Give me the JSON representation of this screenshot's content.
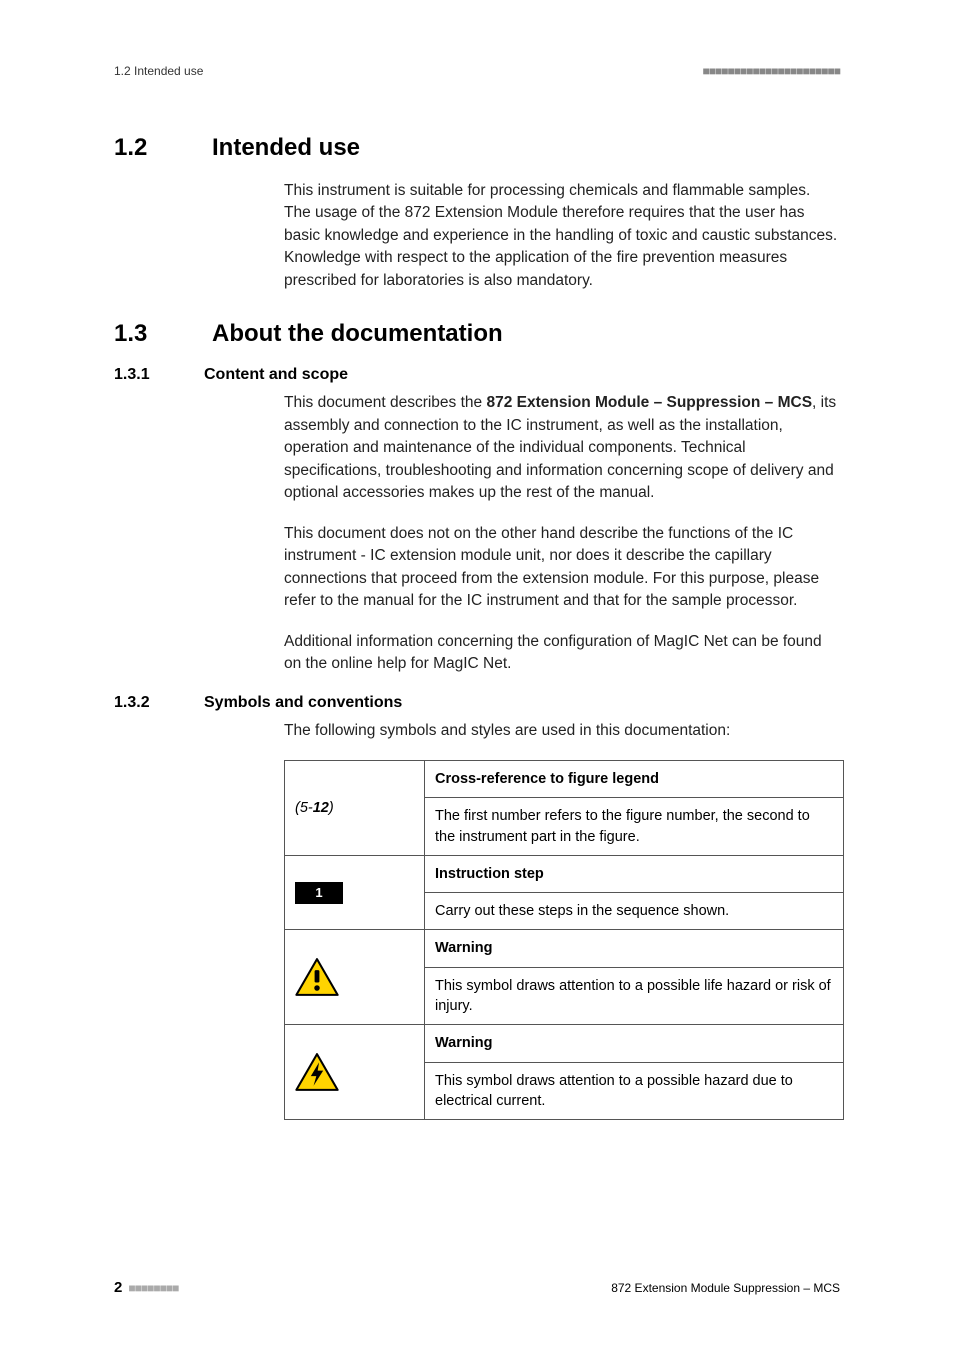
{
  "header": {
    "left": "1.2 Intended use",
    "right_dashes": "■■■■■■■■■■■■■■■■■■■■■■"
  },
  "sections": {
    "s12": {
      "num": "1.2",
      "title": "Intended use",
      "p1": "This instrument is suitable for processing chemicals and flammable samples. The usage of the 872 Extension Module therefore requires that the user has basic knowledge and experience in the handling of toxic and caustic substances. Knowledge with respect to the application of the fire prevention measures prescribed for laboratories is also mandatory."
    },
    "s13": {
      "num": "1.3",
      "title": "About the documentation",
      "s131": {
        "num": "1.3.1",
        "title": "Content and scope",
        "p1_prefix": "This document describes the ",
        "p1_bold": "872 Extension Module – Suppression – MCS",
        "p1_suffix": ", its assembly and connection to the IC instrument, as well as the installation, operation and maintenance of the individual components. Technical specifications, troubleshooting and information concerning scope of delivery and optional accessories makes up the rest of the manual.",
        "p2": "This document does not on the other hand describe the functions of the IC instrument - IC extension module unit, nor does it describe the capillary connections that proceed from the extension module. For this purpose, please refer to the manual for the IC instrument and that for the sample processor.",
        "p3": "Additional information concerning the configuration of MagIC Net can be found on the online help for MagIC Net."
      },
      "s132": {
        "num": "1.3.2",
        "title": "Symbols and conventions",
        "intro": "The following symbols and styles are used in this documentation:"
      }
    }
  },
  "table": {
    "row1": {
      "left_prefix": "(5-",
      "left_bold": "12",
      "left_suffix": ")",
      "heading": "Cross-reference to figure legend",
      "desc": "The first number refers to the figure number, the second to the instrument part in the figure."
    },
    "row2": {
      "left_badge": "1",
      "heading": "Instruction step",
      "desc": "Carry out these steps in the sequence shown."
    },
    "row3": {
      "icon": "warning-exclamation-icon",
      "heading": "Warning",
      "desc": "This symbol draws attention to a possible life hazard or risk of injury."
    },
    "row4": {
      "icon": "warning-electrical-icon",
      "heading": "Warning",
      "desc": "This symbol draws attention to a possible hazard due to electrical current."
    }
  },
  "footer": {
    "page_number": "2",
    "left_dashes": "■■■■■■■■",
    "right": "872 Extension Module Suppression – MCS"
  }
}
